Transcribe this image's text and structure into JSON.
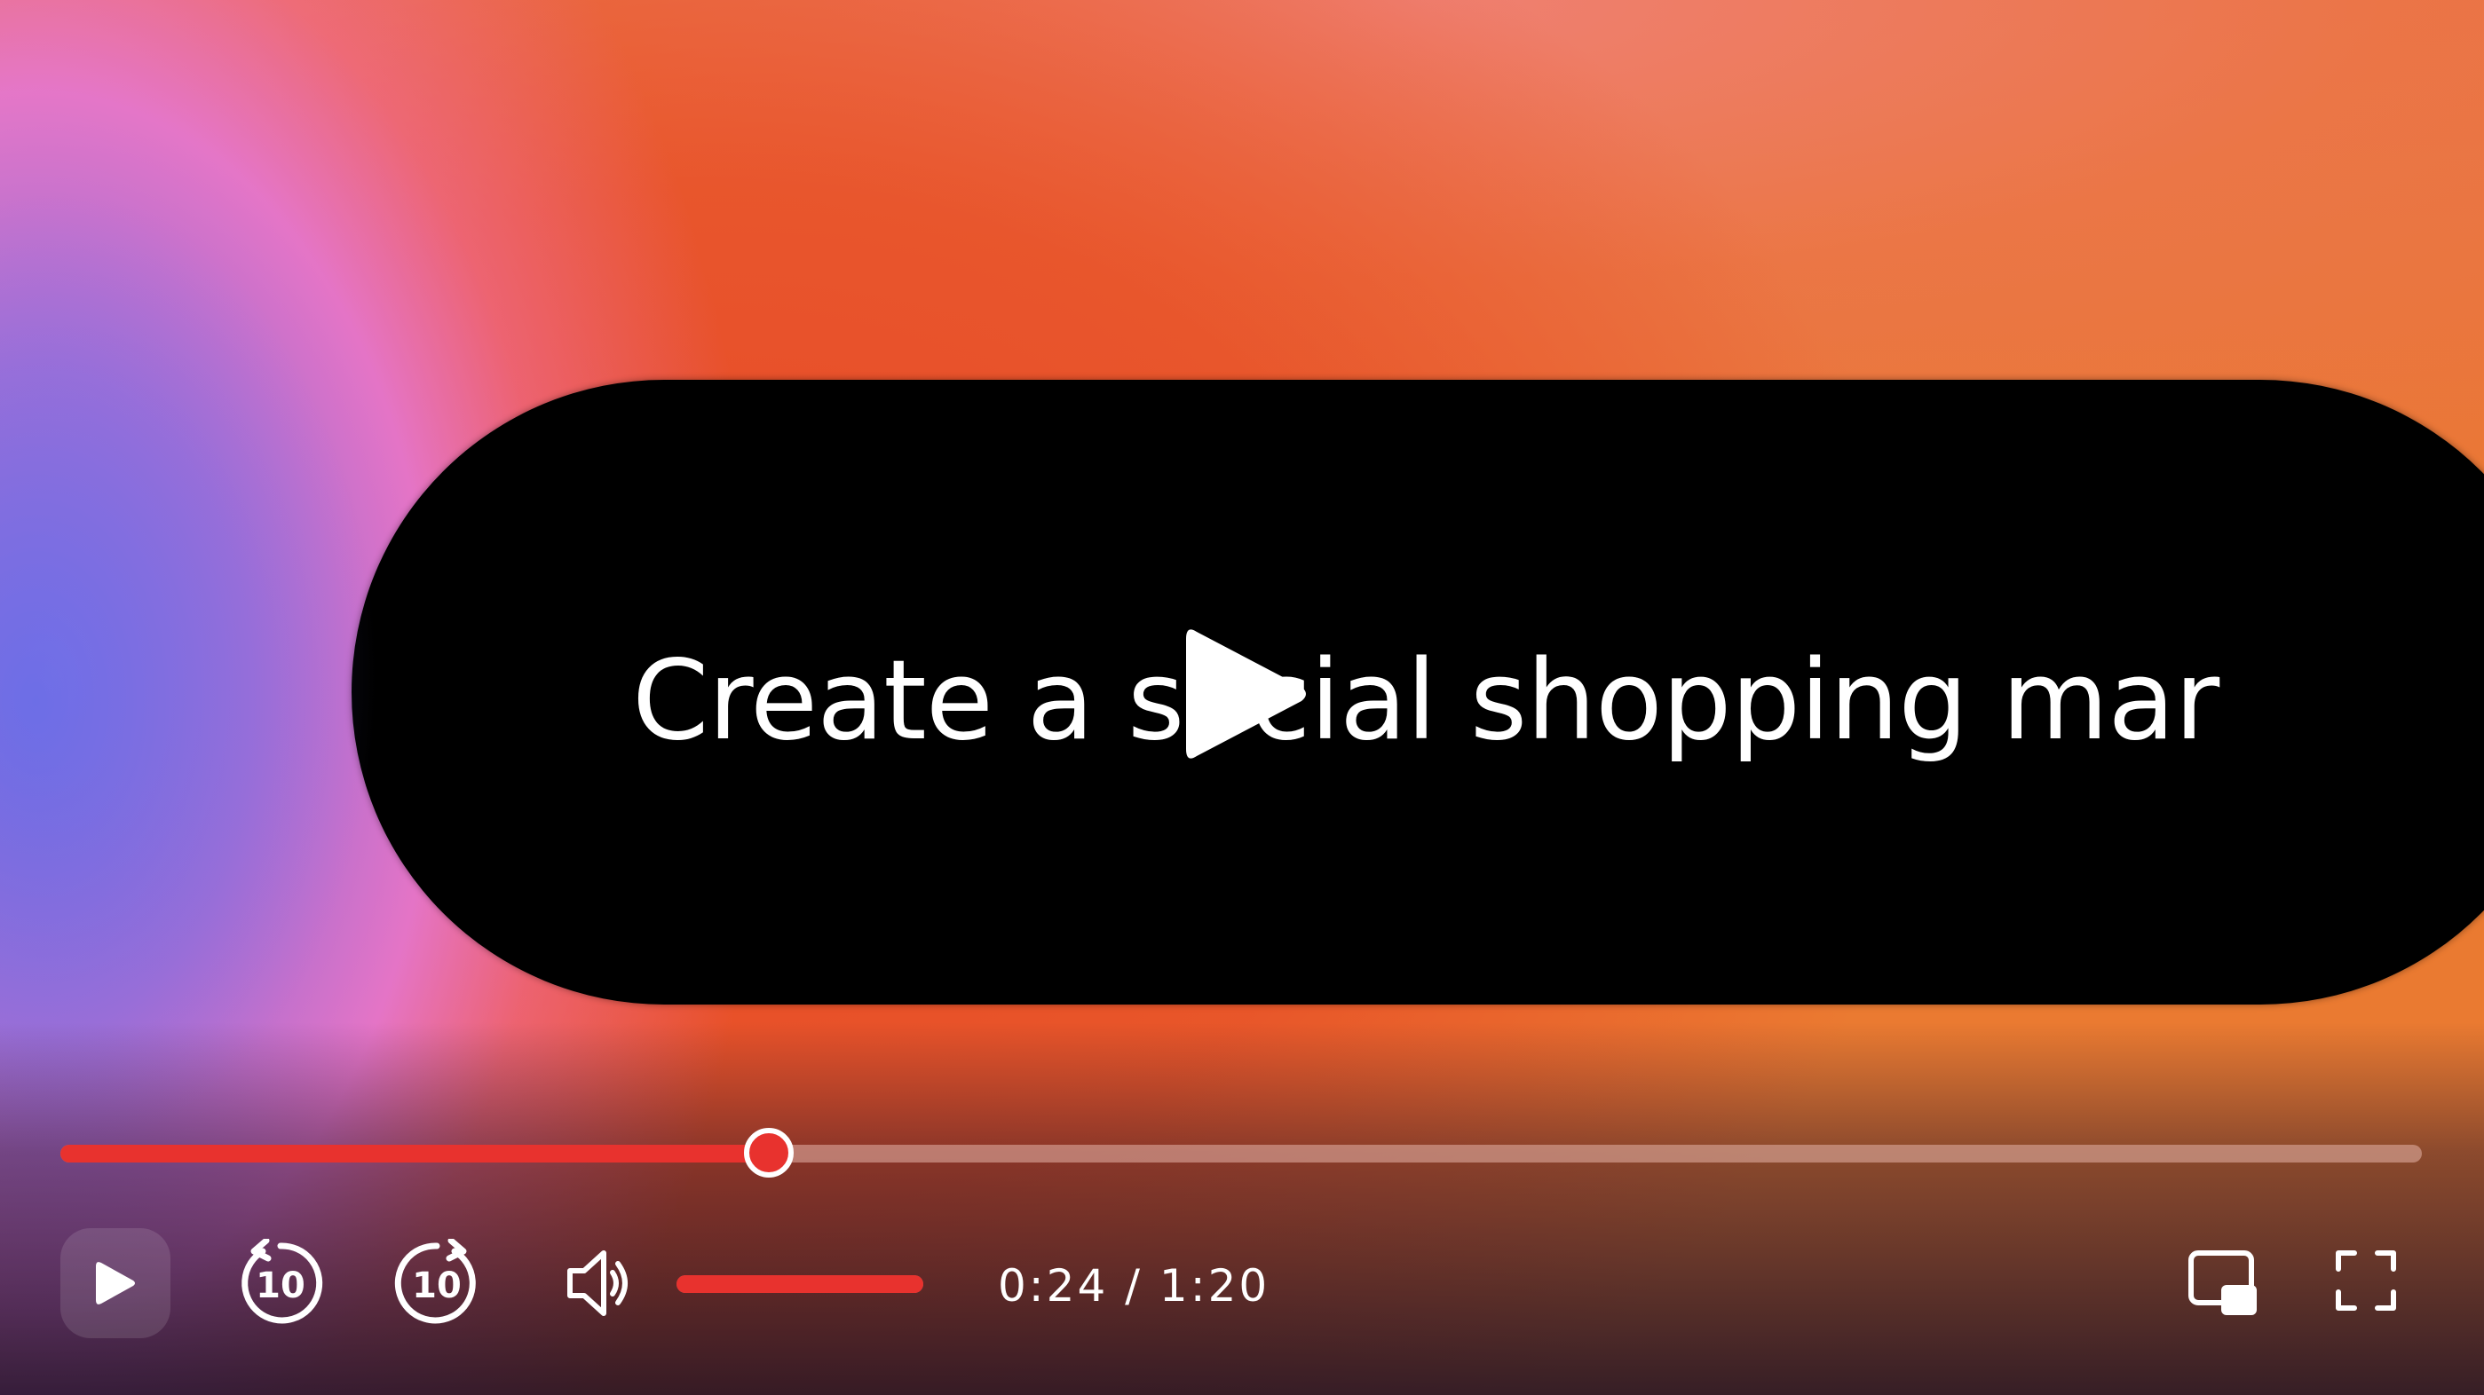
{
  "video": {
    "caption": "Create a social shopping mar"
  },
  "playback": {
    "progress_fraction": 0.3,
    "current_time": "0:24",
    "time_separator": "/",
    "duration": "1:20",
    "time_display": "0:24 / 1:20",
    "volume_fraction": 1.0
  },
  "controls": {
    "play_icon": "play-icon",
    "skip_back_icon": "replay-10-icon",
    "skip_back_number": "10",
    "skip_forward_icon": "forward-10-icon",
    "skip_forward_number": "10",
    "volume_icon": "speaker-icon",
    "pip_icon": "picture-in-picture-icon",
    "fullscreen_icon": "fullscreen-icon"
  },
  "colors": {
    "accent": "#e8322e",
    "pill": "#000000",
    "text": "#ffffff"
  }
}
